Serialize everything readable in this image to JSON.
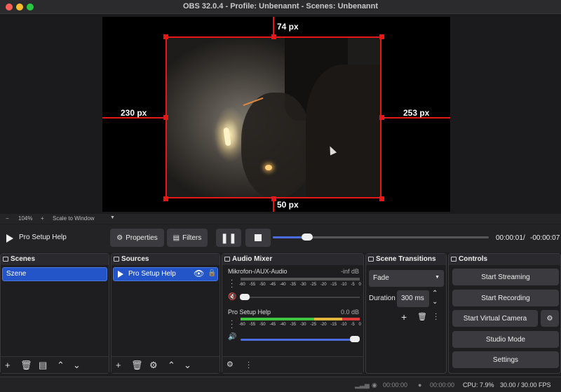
{
  "window": {
    "title": "OBS 32.0.4 - Profile: Unbenannt - Scenes: Unbenannt"
  },
  "preview": {
    "crop_top": "74 px",
    "crop_left": "230 px",
    "crop_right": "253 px",
    "crop_bottom": "50 px",
    "zoom_minus": "−",
    "zoom_level": "104%",
    "zoom_plus": "+",
    "scale_mode": "Scale to Window"
  },
  "media": {
    "source_name": "Pro Setup Help",
    "properties_label": "Properties",
    "filters_label": "Filters",
    "elapsed": "00:00:01",
    "separator": "/",
    "remaining": "-00:00:07",
    "progress": 0.15
  },
  "scenes": {
    "title": "Scenes",
    "items": [
      "Szene"
    ]
  },
  "sources": {
    "title": "Sources",
    "items": [
      "Pro Setup Help"
    ]
  },
  "mixer": {
    "title": "Audio Mixer",
    "channels": [
      {
        "name": "Mikrofon-/AUX-Audio",
        "level": "-inf dB",
        "muted": true
      },
      {
        "name": "Pro Setup Help",
        "level": "0.0 dB",
        "muted": false
      }
    ],
    "ticks": [
      "-60",
      "-55",
      "-50",
      "-45",
      "-40",
      "-35",
      "-30",
      "-25",
      "-20",
      "-15",
      "-10",
      "-5",
      "0"
    ]
  },
  "transitions": {
    "title": "Scene Transitions",
    "selected": "Fade",
    "duration_label": "Duration",
    "duration_value": "300 ms"
  },
  "controls": {
    "title": "Controls",
    "start_streaming": "Start Streaming",
    "start_recording": "Start Recording",
    "start_virtual_camera": "Start Virtual Camera",
    "studio_mode": "Studio Mode",
    "settings": "Settings"
  },
  "status": {
    "stream_time": "00:00:00",
    "record_time": "00:00:00",
    "cpu": "CPU: 7.9%",
    "fps": "30.00 / 30.00 FPS"
  },
  "colors": {
    "accent": "#2355c8",
    "crop_lines": "#e81717",
    "meter_green": "#3ec43e",
    "meter_yellow": "#e0b43a",
    "meter_red": "#d83a3a"
  }
}
